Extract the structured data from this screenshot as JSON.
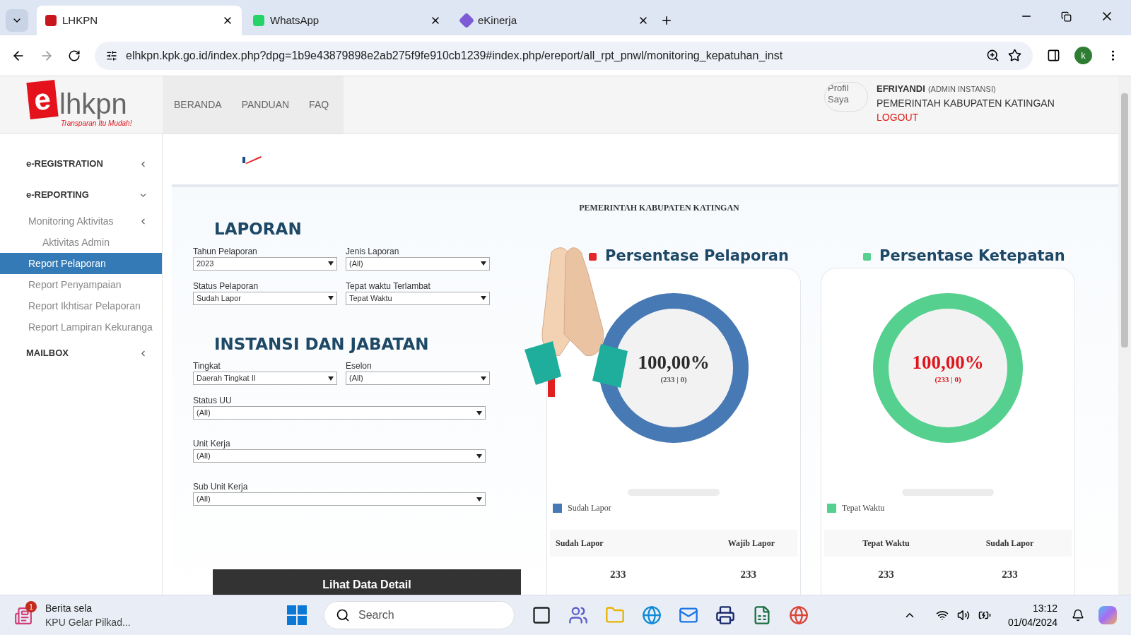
{
  "browser": {
    "tabs": [
      {
        "title": "LHKPN",
        "selected": true
      },
      {
        "title": "WhatsApp",
        "selected": false
      },
      {
        "title": "eKinerja",
        "selected": false
      }
    ],
    "url": "elhkpn.kpk.go.id/index.php?dpg=1b9e43879898e2ab275f9fe910cb1239#index.php/ereport/all_rpt_pnwl/monitoring_kepatuhan_inst",
    "profile_initial": "k"
  },
  "header": {
    "logo": {
      "mark": "e",
      "name": "lhkpn",
      "tagline": "Transparan Itu Mudah!"
    },
    "nav": [
      "BERANDA",
      "PANDUAN",
      "FAQ"
    ],
    "user": {
      "avatar_alt": "Profil Saya",
      "name": "EFRIYANDI",
      "role": "(ADMIN INSTANSI)",
      "org": "PEMERINTAH KABUPATEN KATINGAN",
      "logout": "LOGOUT"
    }
  },
  "sidebar": {
    "items": [
      {
        "label": "e-REGISTRATION",
        "expanded": false
      },
      {
        "label": "e-REPORTING",
        "expanded": true,
        "children": [
          {
            "label": "Monitoring Aktivitas",
            "expanded": false,
            "selected": false,
            "children": [
              {
                "label": "Aktivitas Admin",
                "selected": false
              }
            ]
          },
          {
            "label": "Report Pelaporan",
            "selected": true
          },
          {
            "label": "Report Penyampaian",
            "selected": false
          },
          {
            "label": "Report Ikhtisar Pelaporan",
            "selected": false
          },
          {
            "label": "Report Lampiran Kekuranga",
            "selected": false
          }
        ]
      },
      {
        "label": "MAILBOX",
        "expanded": false
      }
    ]
  },
  "content": {
    "org_title": "PEMERINTAH KABUPATEN KATINGAN",
    "sections": [
      {
        "title": "LAPORAN",
        "fields": [
          {
            "label": "Tahun Pelaporan",
            "value": "2023",
            "kind": "half"
          },
          {
            "label": "Jenis Laporan",
            "value": "(All)",
            "kind": "half"
          },
          {
            "label": "Status Pelaporan",
            "value": "Sudah Lapor",
            "kind": "half"
          },
          {
            "label": "Tepat waktu Terlambat",
            "value": "Tepat Waktu",
            "kind": "half"
          }
        ]
      },
      {
        "title": "INSTANSI DAN JABATAN",
        "fields": [
          {
            "label": "Tingkat",
            "value": "Daerah Tingkat II",
            "kind": "half"
          },
          {
            "label": "Eselon",
            "value": "(All)",
            "kind": "half"
          },
          {
            "label": "Status UU",
            "value": "(All)",
            "kind": "full"
          },
          {
            "label": "Unit Kerja",
            "value": "(All)",
            "kind": "full"
          },
          {
            "label": "Sub Unit Kerja",
            "value": "(All)",
            "kind": "full"
          }
        ]
      }
    ],
    "button": "Lihat Data Detail",
    "cards": [
      {
        "title": "Persentase Pelaporan",
        "color": "#e3262b",
        "percent": "100,00%",
        "detail": "(233 | 0)",
        "alert": false,
        "legend": {
          "label": "Sudah Lapor",
          "color": "#4779b4"
        },
        "columns": [
          "Sudah Lapor",
          "Wajib Lapor"
        ],
        "values": [
          "233",
          "233"
        ]
      },
      {
        "title": "Persentase Ketepatan",
        "color": "#55d08f",
        "percent": "100,00%",
        "detail": "(233 | 0)",
        "alert": true,
        "legend": {
          "label": "Tepat Waktu",
          "color": "#55d08f"
        },
        "columns": [
          "Tepat Waktu",
          "Sudah Lapor"
        ],
        "values": [
          "233",
          "233"
        ]
      }
    ]
  },
  "taskbar": {
    "news": {
      "title": "Berita sela",
      "subtitle": "KPU Gelar Pilkad...",
      "badge": "1"
    },
    "search": {
      "placeholder": "Search"
    },
    "time": "13:12",
    "date": "01/04/2024"
  }
}
